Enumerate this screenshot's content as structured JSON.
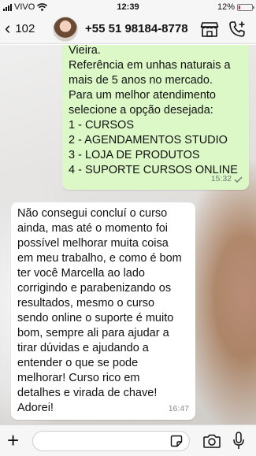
{
  "status_bar": {
    "carrier": "VIVO",
    "time": "12:39",
    "battery_percent": "12%",
    "battery_level": 0.12
  },
  "header": {
    "back_count": "102",
    "contact_name": "+55 51 98184-8778",
    "icons": [
      "chevron-left-icon",
      "avatar",
      "store-icon",
      "add-call-icon"
    ]
  },
  "messages": [
    {
      "direction": "outgoing",
      "lines": [
        "Vieira.",
        "Referência em unhas naturais a",
        "mais de 5 anos no mercado.",
        "Para um melhor atendimento",
        "selecione a opção desejada:",
        "1 - CURSOS",
        "2 - AGENDAMENTOS STUDIO",
        "3 - LOJA DE PRODUTOS",
        "4 - SUPORTE CURSOS ONLINE"
      ],
      "time": "15:32",
      "status": "sent-check"
    },
    {
      "direction": "incoming",
      "lines": [
        "Não consegui concluí o curso",
        "ainda, mas até o momento foi",
        "possível melhorar muita coisa",
        "em meu trabalho, e como é bom",
        "ter você Marcella ao lado",
        "corrigindo e parabenizando os",
        "resultados, mesmo o curso",
        "sendo online o suporte é muito",
        "bom, sempre ali para ajudar a",
        "tirar dúvidas e ajudando a",
        "entender o que se pode",
        "melhorar! Curso rico em",
        "detalhes e virada de chave!",
        "Adorei!"
      ],
      "time": "16:47"
    }
  ],
  "input_bar": {
    "placeholder": "",
    "icons": [
      "plus-icon",
      "sticker-icon",
      "camera-icon",
      "microphone-icon"
    ]
  },
  "colors": {
    "outgoing_bubble": "#dcf8c6",
    "incoming_bubble": "#ffffff",
    "bars": "#f6f6f6",
    "battery_low": "#d02b20"
  }
}
